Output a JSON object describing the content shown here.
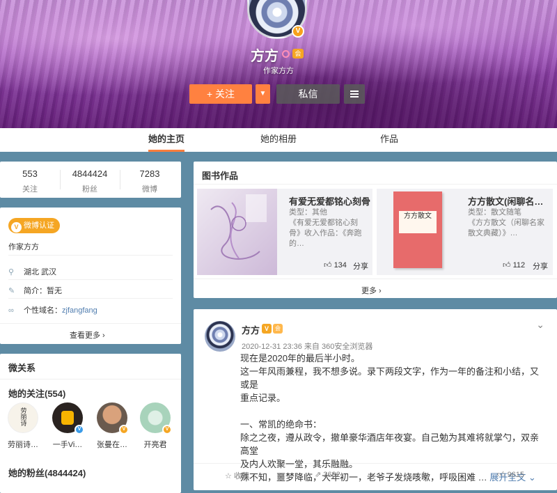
{
  "profile": {
    "name": "方方",
    "subtitle": "作家方方",
    "verified_badge": "V",
    "vip_badge": "会",
    "follow_label": "+ 关注",
    "follow_more_icon": "▼",
    "message_label": "私信",
    "menu_icon": "hamburger-icon"
  },
  "tabs": [
    {
      "label": "她的主页",
      "active": true
    },
    {
      "label": "她的相册",
      "active": false
    },
    {
      "label": "作品",
      "active": false
    }
  ],
  "stats": [
    {
      "value": "553",
      "label": "关注"
    },
    {
      "value": "4844424",
      "label": "粉丝"
    },
    {
      "value": "7283",
      "label": "微博"
    }
  ],
  "info": {
    "verify_label": "微博认证",
    "verify_desc": "作家方方",
    "location": "湖北 武汉",
    "intro_label": "简介：",
    "intro_value": "暂无",
    "domain_label": "个性域名：",
    "domain_value": "zjfangfang",
    "more_label": "查看更多 ›"
  },
  "relations": {
    "title": "微关系",
    "following_title": "她的关注(554)",
    "friends": [
      {
        "name": "劳丽诗…",
        "badge": ""
      },
      {
        "name": "一手Vi…",
        "badge": "blue"
      },
      {
        "name": "张曼在…",
        "badge": "gold"
      },
      {
        "name": "开亮君",
        "badge": "gold"
      }
    ],
    "fans_title": "她的粉丝(4844424)"
  },
  "books": {
    "title": "图书作品",
    "items": [
      {
        "title": "有爱无爱都铭心刻骨",
        "meta": "类型：其他",
        "desc": "《有爱无爱都铭心刻骨》收入作品：《奔跑的…",
        "likes": "134",
        "share": "分享"
      },
      {
        "title": "方方散文(闲聊名…",
        "meta": "类型：散文随笔",
        "desc": "《方方散文（闲聊名家散文典藏）》…",
        "likes": "112",
        "share": "分享",
        "cover_title": "方方散文"
      }
    ],
    "more_label": "更多 ›"
  },
  "post": {
    "author": "方方",
    "verified_badge": "V",
    "vip_badge": "会",
    "meta": "2020-12-31 23:36 来自 360安全浏览器",
    "lines": [
      "现在是2020年的最后半小时。",
      "这一年风雨兼程，我不想多说。录下两段文字，作为一年的备注和小结，又或是",
      "重点记录。",
      "",
      "一、常凯的绝命书：",
      "除之之夜，遵从政令，撤单豪华酒店年夜宴。自己勉为其难将就掌勺，双亲高堂",
      "及内人欢聚一堂，其乐融融。",
      "殊不知，噩梦降临，大年初一，老爷子发烧咳嗽，呼吸困难 …"
    ],
    "expand_label": "展开全文 ⌄",
    "actions": {
      "collect": "收藏",
      "repost": "3682",
      "comment": "1",
      "like": "9615"
    }
  },
  "colors": {
    "accent": "#ff8140",
    "tab_underline": "#fa7d3c",
    "verify": "#f5a623",
    "link_blue": "#507daf",
    "page_bg": "#5e8ba4"
  }
}
